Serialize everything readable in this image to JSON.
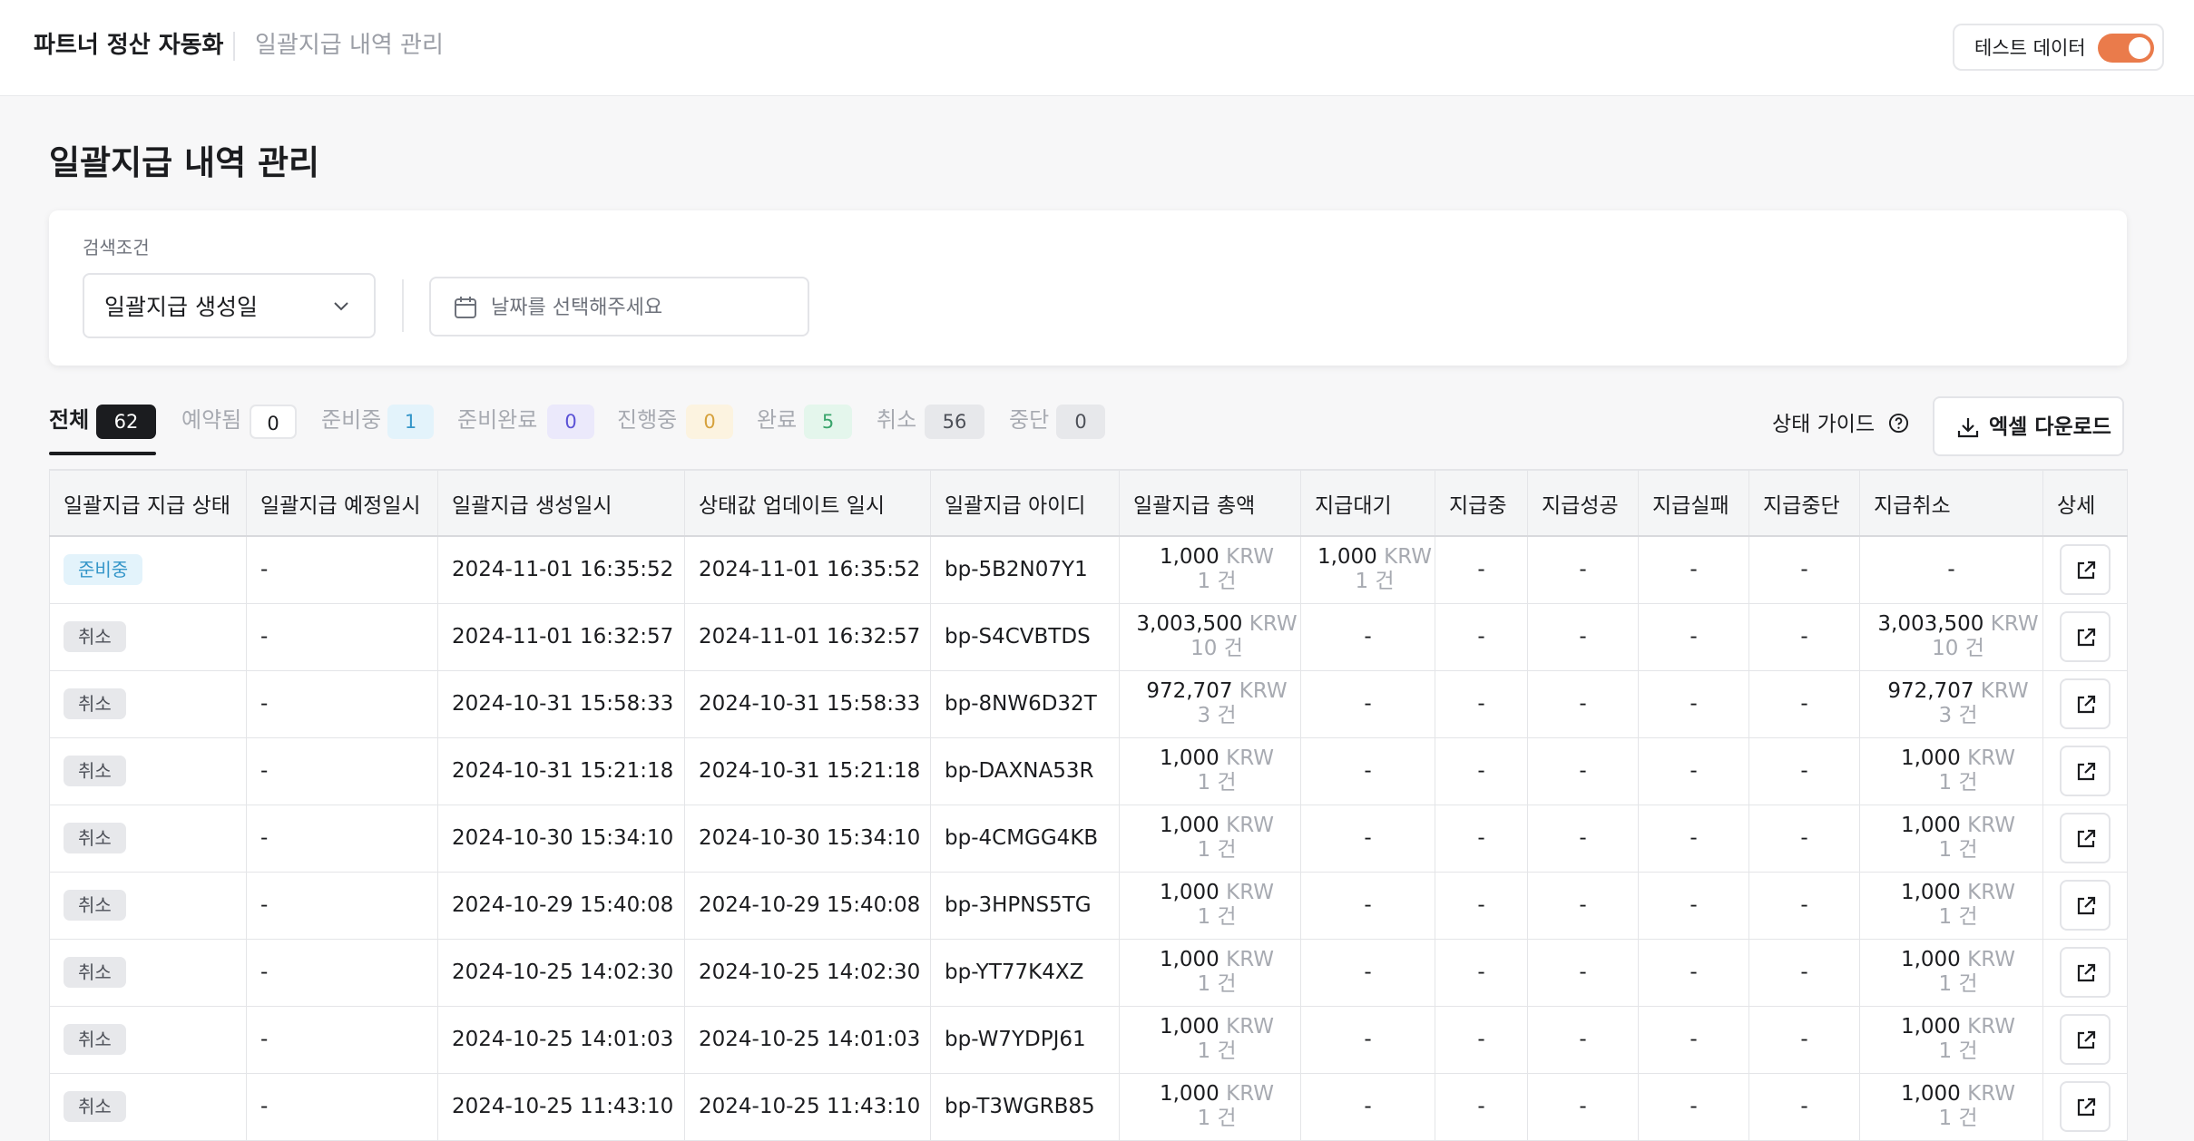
{
  "header": {
    "app_title": "파트너 정산 자동화",
    "breadcrumb": "일괄지급 내역 관리",
    "test_data_label": "테스트 데이터",
    "test_data_on": true
  },
  "page": {
    "title": "일괄지급 내역 관리"
  },
  "search": {
    "label": "검색조건",
    "date_type": "일괄지급 생성일",
    "date_placeholder": "날짜를 선택해주세요"
  },
  "tabs": [
    {
      "label": "전체",
      "count": "62"
    },
    {
      "label": "예약됨",
      "count": "0"
    },
    {
      "label": "준비중",
      "count": "1"
    },
    {
      "label": "준비완료",
      "count": "0"
    },
    {
      "label": "진행중",
      "count": "0"
    },
    {
      "label": "완료",
      "count": "5"
    },
    {
      "label": "취소",
      "count": "56"
    },
    {
      "label": "중단",
      "count": "0"
    }
  ],
  "actions": {
    "status_guide": "상태 가이드",
    "excel_download": "엑셀 다운로드"
  },
  "table": {
    "columns": [
      "일괄지급 지급 상태",
      "일괄지급 예정일시",
      "일괄지급 생성일시",
      "상태값 업데이트 일시",
      "일괄지급 아이디",
      "일괄지급 총액",
      "지급대기",
      "지급중",
      "지급성공",
      "지급실패",
      "지급중단",
      "지급취소",
      "상세"
    ],
    "rows": [
      {
        "status": "준비중",
        "scheduled": "-",
        "created": "2024-11-01 16:35:52",
        "updated": "2024-11-01 16:35:52",
        "id": "bp-5B2N07Y1",
        "total": "1,000",
        "total_count": "1 건",
        "waiting": "1,000",
        "waiting_count": "1 건",
        "paying": "-",
        "success": "-",
        "failed": "-",
        "stopped": "-",
        "cancelled": "-",
        "cancelled_count": ""
      },
      {
        "status": "취소",
        "scheduled": "-",
        "created": "2024-11-01 16:32:57",
        "updated": "2024-11-01 16:32:57",
        "id": "bp-S4CVBTDS",
        "total": "3,003,500",
        "total_count": "10 건",
        "waiting": "-",
        "waiting_count": "",
        "paying": "-",
        "success": "-",
        "failed": "-",
        "stopped": "-",
        "cancelled": "3,003,500",
        "cancelled_count": "10 건"
      },
      {
        "status": "취소",
        "scheduled": "-",
        "created": "2024-10-31 15:58:33",
        "updated": "2024-10-31 15:58:33",
        "id": "bp-8NW6D32T",
        "total": "972,707",
        "total_count": "3 건",
        "waiting": "-",
        "waiting_count": "",
        "paying": "-",
        "success": "-",
        "failed": "-",
        "stopped": "-",
        "cancelled": "972,707",
        "cancelled_count": "3 건"
      },
      {
        "status": "취소",
        "scheduled": "-",
        "created": "2024-10-31 15:21:18",
        "updated": "2024-10-31 15:21:18",
        "id": "bp-DAXNA53R",
        "total": "1,000",
        "total_count": "1 건",
        "waiting": "-",
        "waiting_count": "",
        "paying": "-",
        "success": "-",
        "failed": "-",
        "stopped": "-",
        "cancelled": "1,000",
        "cancelled_count": "1 건"
      },
      {
        "status": "취소",
        "scheduled": "-",
        "created": "2024-10-30 15:34:10",
        "updated": "2024-10-30 15:34:10",
        "id": "bp-4CMGG4KB",
        "total": "1,000",
        "total_count": "1 건",
        "waiting": "-",
        "waiting_count": "",
        "paying": "-",
        "success": "-",
        "failed": "-",
        "stopped": "-",
        "cancelled": "1,000",
        "cancelled_count": "1 건"
      },
      {
        "status": "취소",
        "scheduled": "-",
        "created": "2024-10-29 15:40:08",
        "updated": "2024-10-29 15:40:08",
        "id": "bp-3HPNS5TG",
        "total": "1,000",
        "total_count": "1 건",
        "waiting": "-",
        "waiting_count": "",
        "paying": "-",
        "success": "-",
        "failed": "-",
        "stopped": "-",
        "cancelled": "1,000",
        "cancelled_count": "1 건"
      },
      {
        "status": "취소",
        "scheduled": "-",
        "created": "2024-10-25 14:02:30",
        "updated": "2024-10-25 14:02:30",
        "id": "bp-YT77K4XZ",
        "total": "1,000",
        "total_count": "1 건",
        "waiting": "-",
        "waiting_count": "",
        "paying": "-",
        "success": "-",
        "failed": "-",
        "stopped": "-",
        "cancelled": "1,000",
        "cancelled_count": "1 건"
      },
      {
        "status": "취소",
        "scheduled": "-",
        "created": "2024-10-25 14:01:03",
        "updated": "2024-10-25 14:01:03",
        "id": "bp-W7YDPJ61",
        "total": "1,000",
        "total_count": "1 건",
        "waiting": "-",
        "waiting_count": "",
        "paying": "-",
        "success": "-",
        "failed": "-",
        "stopped": "-",
        "cancelled": "1,000",
        "cancelled_count": "1 건"
      },
      {
        "status": "취소",
        "scheduled": "-",
        "created": "2024-10-25 11:43:10",
        "updated": "2024-10-25 11:43:10",
        "id": "bp-T3WGRB85",
        "total": "1,000",
        "total_count": "1 건",
        "waiting": "-",
        "waiting_count": "",
        "paying": "-",
        "success": "-",
        "failed": "-",
        "stopped": "-",
        "cancelled": "1,000",
        "cancelled_count": "1 건"
      }
    ],
    "currency": "KRW"
  },
  "colors": {
    "accent_toggle": "#ea7b4b",
    "badge_ready_bg": "#e3f3fb",
    "badge_ready_fg": "#3596c9",
    "badge_cancel_bg": "#e7e8eb"
  },
  "icons": {
    "chevron": "chevron-down-icon",
    "calendar": "calendar-icon",
    "help": "help-circle-icon",
    "download": "download-icon",
    "open": "external-link-icon"
  }
}
